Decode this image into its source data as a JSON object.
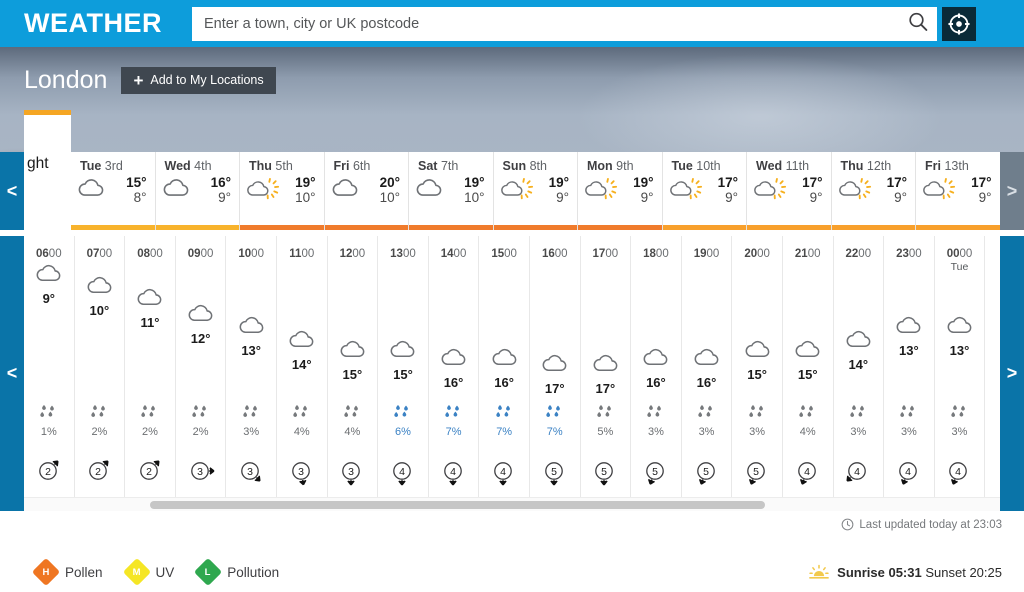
{
  "masthead": {
    "brand": "WEATHER",
    "search_placeholder": "Enter a town, city or UK postcode",
    "search_value": "",
    "search_icon": "search-icon",
    "location_icon": "crosshair-location-icon"
  },
  "hero": {
    "location": "London",
    "add_button_label": "Add to My Locations",
    "add_button_icon": "plus-icon"
  },
  "day_strip": {
    "prev_label": "<",
    "next_label": ">",
    "selected_tab": {
      "label": "ght",
      "full_label": "Tonight",
      "bar_color": "#f5a623"
    },
    "days": [
      {
        "weekday": "Tue",
        "date": "3rd",
        "icon": "cloudy-icon",
        "high": "15°",
        "low": "8°",
        "bar_color": "#f8b32c"
      },
      {
        "weekday": "Wed",
        "date": "4th",
        "icon": "cloudy-icon",
        "high": "16°",
        "low": "9°",
        "bar_color": "#f8b32c"
      },
      {
        "weekday": "Thu",
        "date": "5th",
        "icon": "sunny-intervals-icon",
        "high": "19°",
        "low": "10°",
        "bar_color": "#f07b2c"
      },
      {
        "weekday": "Fri",
        "date": "6th",
        "icon": "cloudy-icon",
        "high": "20°",
        "low": "10°",
        "bar_color": "#f07b2c"
      },
      {
        "weekday": "Sat",
        "date": "7th",
        "icon": "cloudy-icon",
        "high": "19°",
        "low": "10°",
        "bar_color": "#f07b2c"
      },
      {
        "weekday": "Sun",
        "date": "8th",
        "icon": "sunny-intervals-icon",
        "high": "19°",
        "low": "9°",
        "bar_color": "#f07b2c"
      },
      {
        "weekday": "Mon",
        "date": "9th",
        "icon": "sunny-intervals-icon",
        "high": "19°",
        "low": "9°",
        "bar_color": "#f07b2c"
      },
      {
        "weekday": "Tue",
        "date": "10th",
        "icon": "sunny-intervals-icon",
        "high": "17°",
        "low": "9°",
        "bar_color": "#f8a02c"
      },
      {
        "weekday": "Wed",
        "date": "11th",
        "icon": "sunny-intervals-icon",
        "high": "17°",
        "low": "9°",
        "bar_color": "#f8a02c"
      },
      {
        "weekday": "Thu",
        "date": "12th",
        "icon": "sunny-intervals-icon",
        "high": "17°",
        "low": "9°",
        "bar_color": "#f8a02c"
      },
      {
        "weekday": "Fri",
        "date": "13th",
        "icon": "sunny-intervals-icon",
        "high": "17°",
        "low": "9°",
        "bar_color": "#f8a02c"
      }
    ]
  },
  "hourly": {
    "prev_label": "<",
    "next_label": ">",
    "columns": [
      {
        "time": "0600",
        "sub": "",
        "icon": "cloudy-icon",
        "temp": "9°",
        "rain": "1%",
        "rain_blue": false,
        "wind_speed": "2",
        "wind_dir": 225
      },
      {
        "time": "0700",
        "sub": "",
        "icon": "cloudy-icon",
        "temp": "10°",
        "rain": "2%",
        "rain_blue": false,
        "wind_speed": "2",
        "wind_dir": 225
      },
      {
        "time": "0800",
        "sub": "",
        "icon": "cloudy-icon",
        "temp": "11°",
        "rain": "2%",
        "rain_blue": false,
        "wind_speed": "2",
        "wind_dir": 225
      },
      {
        "time": "0900",
        "sub": "",
        "icon": "cloudy-icon",
        "temp": "12°",
        "rain": "2%",
        "rain_blue": false,
        "wind_speed": "3",
        "wind_dir": 270
      },
      {
        "time": "1000",
        "sub": "",
        "icon": "cloudy-icon",
        "temp": "13°",
        "rain": "3%",
        "rain_blue": false,
        "wind_speed": "3",
        "wind_dir": 315
      },
      {
        "time": "1100",
        "sub": "",
        "icon": "cloudy-icon",
        "temp": "14°",
        "rain": "4%",
        "rain_blue": false,
        "wind_speed": "3",
        "wind_dir": 350
      },
      {
        "time": "1200",
        "sub": "",
        "icon": "cloudy-icon",
        "temp": "15°",
        "rain": "4%",
        "rain_blue": false,
        "wind_speed": "3",
        "wind_dir": 0
      },
      {
        "time": "1300",
        "sub": "",
        "icon": "cloudy-icon",
        "temp": "15°",
        "rain": "6%",
        "rain_blue": true,
        "wind_speed": "4",
        "wind_dir": 0
      },
      {
        "time": "1400",
        "sub": "",
        "icon": "cloudy-icon",
        "temp": "16°",
        "rain": "7%",
        "rain_blue": true,
        "wind_speed": "4",
        "wind_dir": 0
      },
      {
        "time": "1500",
        "sub": "",
        "icon": "cloudy-icon",
        "temp": "16°",
        "rain": "7%",
        "rain_blue": true,
        "wind_speed": "4",
        "wind_dir": 0
      },
      {
        "time": "1600",
        "sub": "",
        "icon": "cloudy-icon",
        "temp": "17°",
        "rain": "7%",
        "rain_blue": true,
        "wind_speed": "5",
        "wind_dir": 0
      },
      {
        "time": "1700",
        "sub": "",
        "icon": "cloudy-icon",
        "temp": "17°",
        "rain": "5%",
        "rain_blue": false,
        "wind_speed": "5",
        "wind_dir": 0
      },
      {
        "time": "1800",
        "sub": "",
        "icon": "cloudy-icon",
        "temp": "16°",
        "rain": "3%",
        "rain_blue": false,
        "wind_speed": "5",
        "wind_dir": 20
      },
      {
        "time": "1900",
        "sub": "",
        "icon": "cloudy-icon",
        "temp": "16°",
        "rain": "3%",
        "rain_blue": false,
        "wind_speed": "5",
        "wind_dir": 20
      },
      {
        "time": "2000",
        "sub": "",
        "icon": "cloudy-icon",
        "temp": "15°",
        "rain": "3%",
        "rain_blue": false,
        "wind_speed": "5",
        "wind_dir": 20
      },
      {
        "time": "2100",
        "sub": "",
        "icon": "cloudy-icon",
        "temp": "15°",
        "rain": "4%",
        "rain_blue": false,
        "wind_speed": "4",
        "wind_dir": 20
      },
      {
        "time": "2200",
        "sub": "",
        "icon": "cloudy-icon",
        "temp": "14°",
        "rain": "3%",
        "rain_blue": false,
        "wind_speed": "4",
        "wind_dir": 45
      },
      {
        "time": "2300",
        "sub": "",
        "icon": "cloudy-icon",
        "temp": "13°",
        "rain": "3%",
        "rain_blue": false,
        "wind_speed": "4",
        "wind_dir": 20
      },
      {
        "time": "0000",
        "sub": "Tue",
        "icon": "cloudy-icon",
        "temp": "13°",
        "rain": "3%",
        "rain_blue": false,
        "wind_speed": "4",
        "wind_dir": 20
      }
    ]
  },
  "footer": {
    "last_updated": "Last updated today at 23:03",
    "clock_icon": "clock-icon",
    "indicators": [
      {
        "label": "Pollen",
        "level": "H",
        "color": "#ef7622"
      },
      {
        "label": "UV",
        "level": "M",
        "color": "#f5e625"
      },
      {
        "label": "Pollution",
        "level": "L",
        "color": "#2fa84f"
      }
    ],
    "sun_icon": "sunrise-icon",
    "sunrise_label": "Sunrise",
    "sunrise_time": "05:31",
    "sunset_label": "Sunset",
    "sunset_time": "20:25"
  }
}
